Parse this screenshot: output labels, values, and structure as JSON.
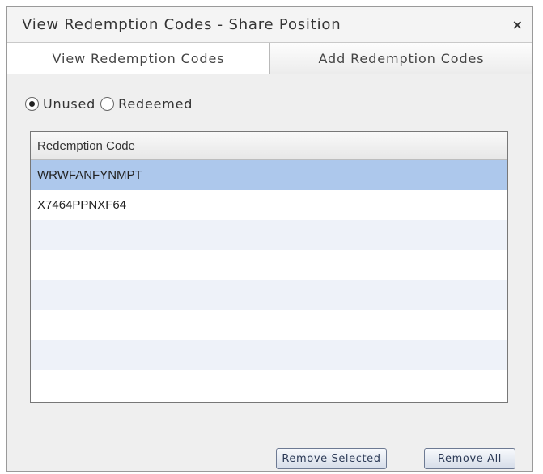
{
  "dialog": {
    "title": "View Redemption Codes - Share Position",
    "close_glyph": "×"
  },
  "tabs": [
    {
      "label": "View Redemption Codes",
      "active": true
    },
    {
      "label": "Add Redemption Codes",
      "active": false
    }
  ],
  "filter": {
    "options": [
      {
        "label": "Unused",
        "checked": true
      },
      {
        "label": "Redeemed",
        "checked": false
      }
    ]
  },
  "table": {
    "header": "Redemption Code",
    "rows": [
      {
        "code": "WRWFANFYNMPT",
        "selected": true
      },
      {
        "code": "X7464PPNXF64",
        "selected": false
      },
      {
        "code": "",
        "selected": false
      },
      {
        "code": "",
        "selected": false
      },
      {
        "code": "",
        "selected": false
      },
      {
        "code": "",
        "selected": false
      },
      {
        "code": "",
        "selected": false
      },
      {
        "code": "",
        "selected": false
      }
    ]
  },
  "buttons": {
    "remove_selected": "Remove Selected",
    "remove_all": "Remove All"
  },
  "colors": {
    "selected_row": "#adc8ec",
    "alt_row": "#eef2f9"
  }
}
